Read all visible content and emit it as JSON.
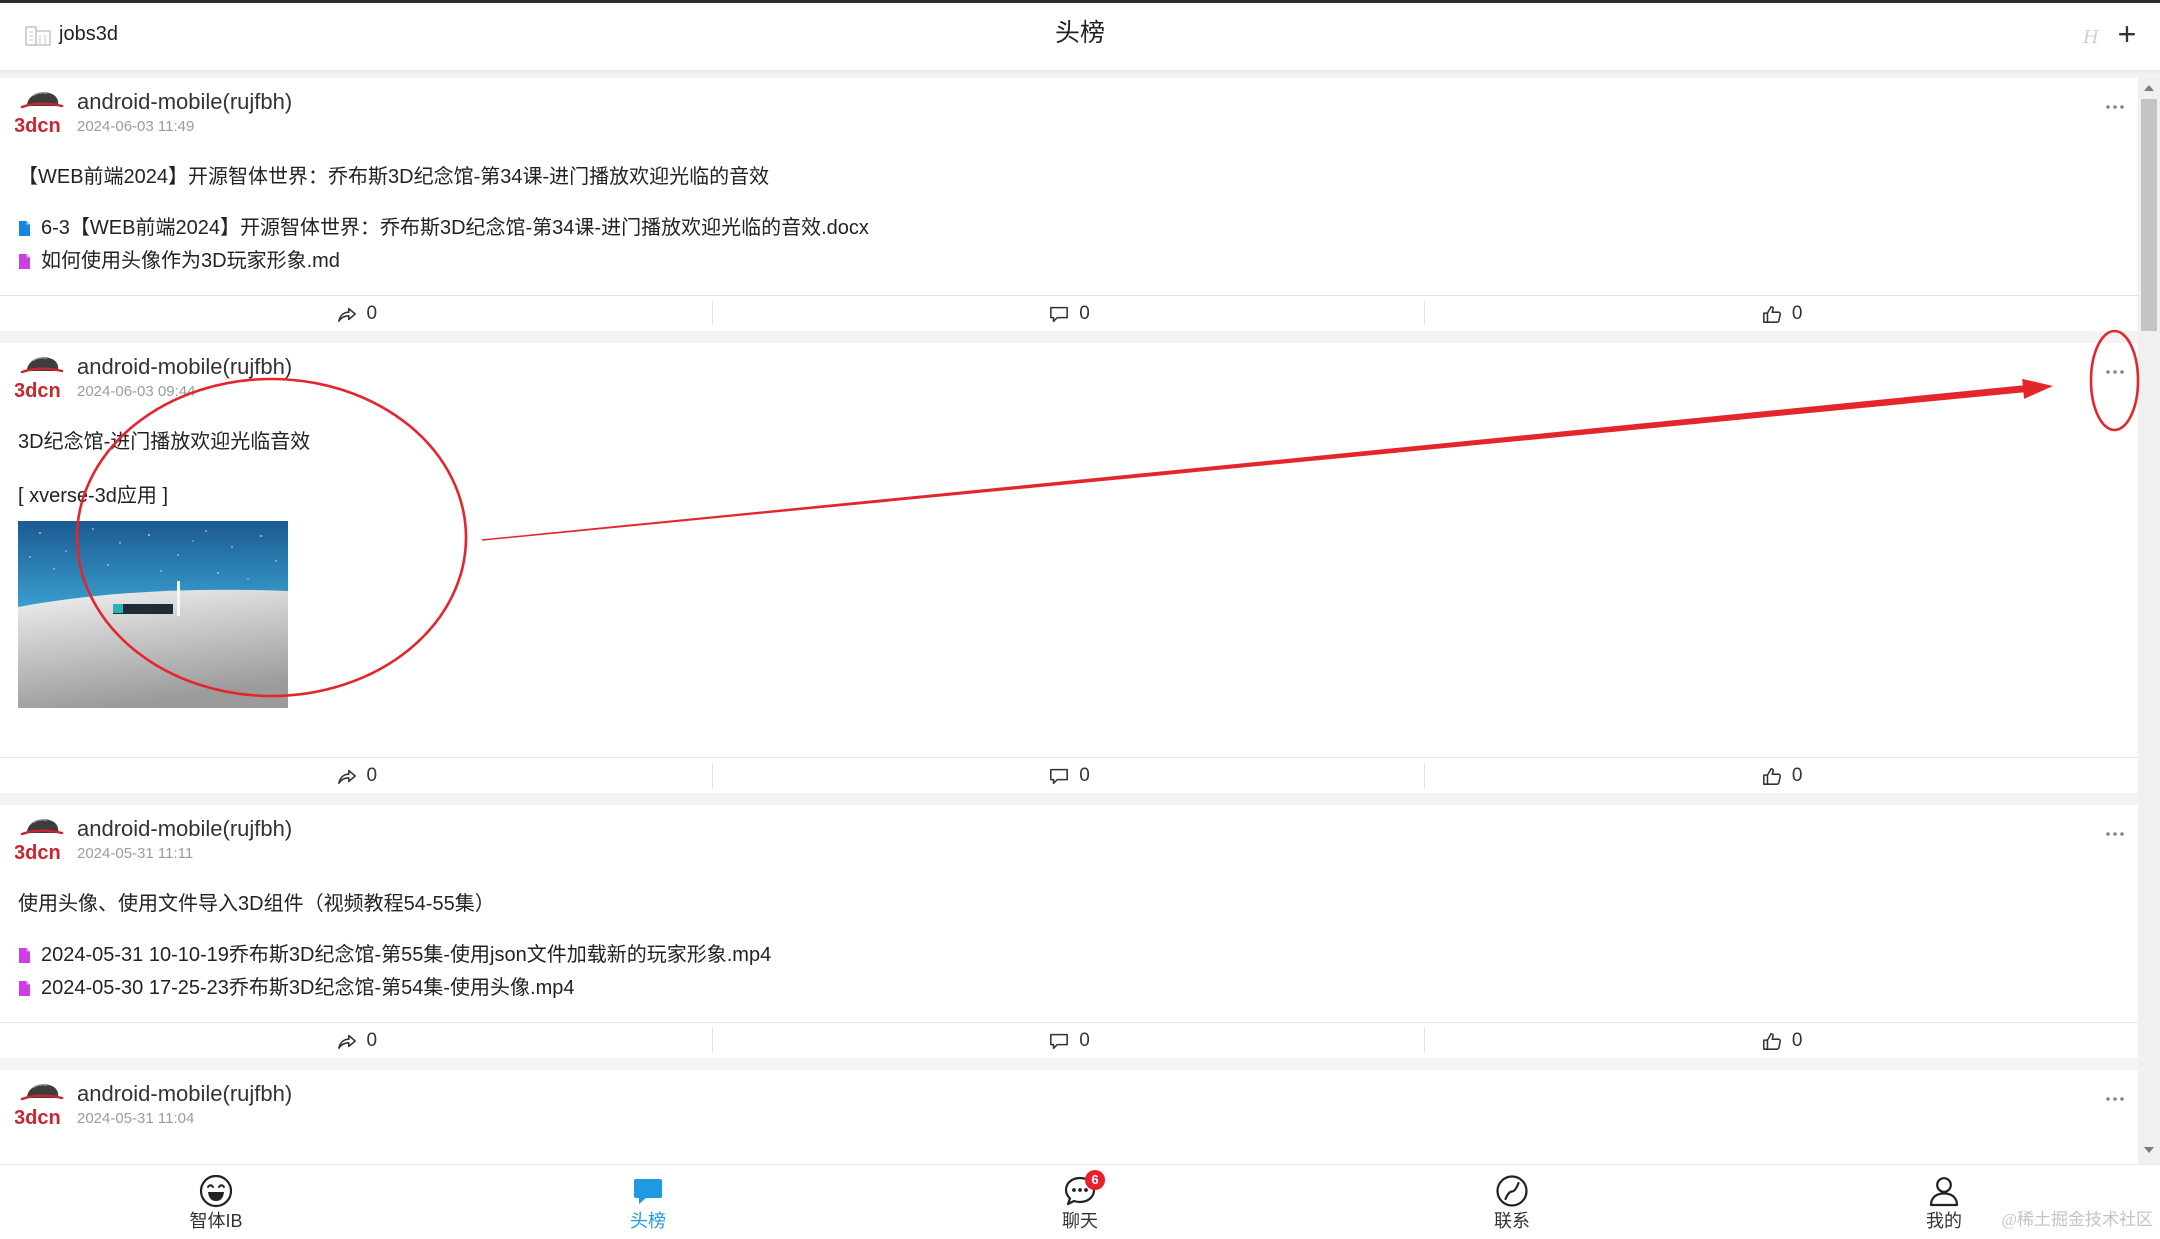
{
  "header": {
    "app_icon": "jobs3d-logo-icon",
    "app_name": "jobs3d",
    "title": "头榜",
    "h_label": "H",
    "add_label": "+"
  },
  "avatar_logo_text": "3dcn",
  "posts": [
    {
      "author": "android-mobile(rujfbh)",
      "time": "2024-06-03 11:49",
      "text": "【WEB前端2024】开源智体世界：乔布斯3D纪念馆-第34课-进门播放欢迎光临的音效",
      "attachments": [
        {
          "name": "6-3【WEB前端2024】开源智体世界：乔布斯3D纪念馆-第34课-进门播放欢迎光临的音效.docx",
          "icon": "docx-file-icon",
          "color": "#1a85e0"
        },
        {
          "name": "如何使用头像作为3D玩家形象.md",
          "icon": "md-file-icon",
          "color": "#cc3fe0"
        }
      ],
      "share_count": "0",
      "comment_count": "0",
      "like_count": "0"
    },
    {
      "author": "android-mobile(rujfbh)",
      "time": "2024-06-03 09:44",
      "text": "3D纪念馆-进门播放欢迎光临音效",
      "tag": "[ xverse-3d应用 ]",
      "share_count": "0",
      "comment_count": "0",
      "like_count": "0"
    },
    {
      "author": "android-mobile(rujfbh)",
      "time": "2024-05-31 11:11",
      "text": "使用头像、使用文件导入3D组件（视频教程54-55集）",
      "attachments": [
        {
          "name": "2024-05-31 10-10-19乔布斯3D纪念馆-第55集-使用json文件加载新的玩家形象.mp4",
          "icon": "mp4-file-icon",
          "color": "#cc3fe0"
        },
        {
          "name": "2024-05-30 17-25-23乔布斯3D纪念馆-第54集-使用头像.mp4",
          "icon": "mp4-file-icon",
          "color": "#cc3fe0"
        }
      ],
      "share_count": "0",
      "comment_count": "0",
      "like_count": "0"
    },
    {
      "author": "android-mobile(rujfbh)",
      "time": "2024-05-31 11:04"
    }
  ],
  "tabs": [
    {
      "label": "智体IB",
      "icon": "laughing-face-icon"
    },
    {
      "label": "头榜",
      "icon": "chat-bubble-filled-icon",
      "active": true
    },
    {
      "label": "聊天",
      "icon": "chat-dots-icon",
      "badge": "6"
    },
    {
      "label": "联系",
      "icon": "compass-icon"
    },
    {
      "label": "我的",
      "icon": "user-icon"
    }
  ],
  "watermark": "@稀土掘金技术社区",
  "colors": {
    "accent": "#1f9ae0",
    "badge": "#e8202a",
    "annotation": "#e3262b",
    "avatar_logo": "#c8262c"
  }
}
